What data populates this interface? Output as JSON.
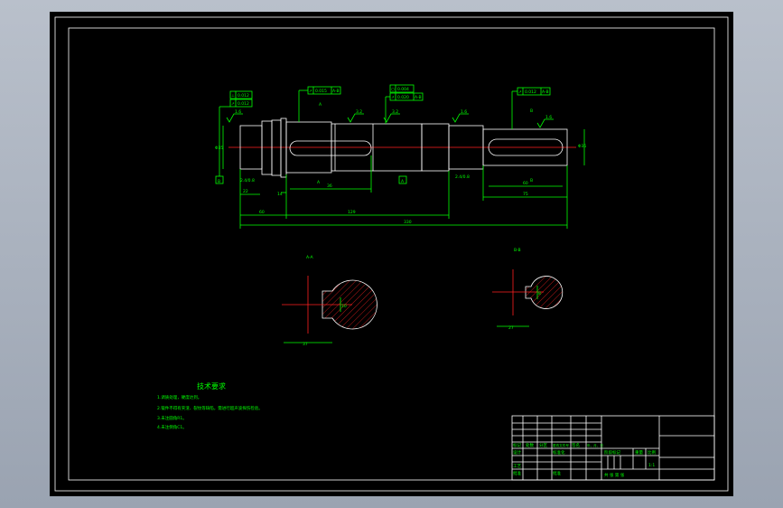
{
  "drawing": {
    "tech_requirements_title": "技术要求",
    "tech_requirements": [
      "1.调质处理，硬度达到。",
      "2.锻件不得有夹渣、裂纹等缺陷，需进行超声波探伤检验。",
      "3.未注圆角R1。",
      "4.未注倒角C1。"
    ],
    "section_a": "A-A",
    "section_b": "B-B",
    "dims": {
      "total_length": "330",
      "len_mid": "129",
      "len_left": "60",
      "len_right_key": "75",
      "section_a_dia": "37",
      "section_b_dia": "27",
      "section_a_key": "10",
      "section_b_key": "8",
      "dia_left": "Φ35",
      "dia_right": "Φ35",
      "left_collar": "2.4/0.8",
      "mid_small": "14",
      "key_a_len": "36",
      "key_b_len": "60",
      "right_chamfer": "2.4/0.8",
      "left_small": "22"
    },
    "roughness": [
      "1.6",
      "3.2",
      "3.2",
      "1.6",
      "1.6"
    ],
    "tolerance_frames": [
      [
        "⊥",
        "0.012",
        "B"
      ],
      [
        "↗",
        "0.012",
        "A"
      ],
      [
        "↗",
        "0.015",
        "A-B"
      ],
      [
        "○",
        "0.004",
        ""
      ],
      [
        "↗",
        "0.020",
        "A-B"
      ],
      [
        "↗",
        "0.012",
        "A-B"
      ]
    ],
    "datums": [
      "B",
      "A"
    ],
    "section_labels": [
      "A",
      "A",
      "B",
      "B"
    ]
  },
  "title_block": {
    "row_labels": [
      "标记",
      "处数",
      "分区",
      "更改文件号",
      "签名",
      "年、月、日"
    ],
    "design": "设计",
    "standard": "标准化",
    "stage": "阶段标记",
    "weight": "重量",
    "scale": "比例",
    "scale_value": "1:1",
    "process": "工艺",
    "approve": "批准",
    "sheet": "共  张  第  张"
  }
}
